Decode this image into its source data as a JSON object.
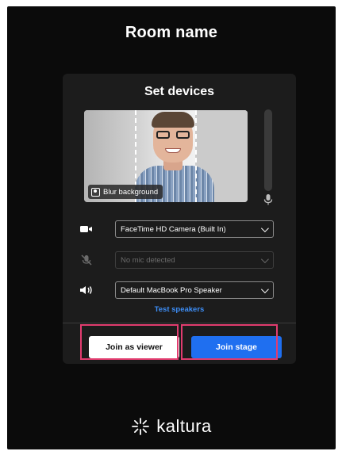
{
  "room": {
    "title": "Room name"
  },
  "panel": {
    "title": "Set devices",
    "preview": {
      "blur_label": "Blur background"
    },
    "camera": {
      "icon": "video-camera-icon",
      "selected": "FaceTime HD Camera (Built In)"
    },
    "microphone": {
      "icon": "mic-off-icon",
      "selected": "No mic detected",
      "disabled": true
    },
    "speaker": {
      "icon": "speaker-icon",
      "selected": "Default MacBook Pro Speaker"
    },
    "test_speakers_label": "Test speakers",
    "join_viewer_label": "Join as viewer",
    "join_stage_label": "Join stage"
  },
  "brand": {
    "name": "kaltura",
    "logo_icon": "kaltura-logo-icon"
  },
  "colors": {
    "background": "#0b0b0b",
    "panel": "#1c1c1c",
    "primary": "#1f6ff0",
    "link": "#3d8ef7",
    "highlight": "#e23c6f"
  }
}
